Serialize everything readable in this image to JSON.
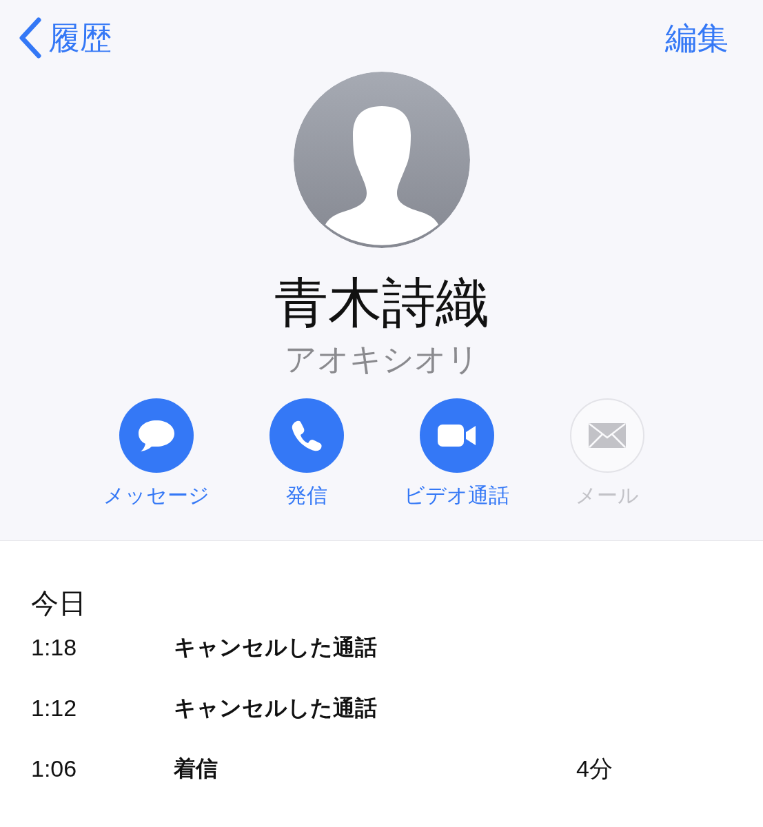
{
  "nav": {
    "back": "履歴",
    "edit": "編集"
  },
  "contact": {
    "name": "青木詩織",
    "reading": "アオキシオリ"
  },
  "actions": [
    {
      "label": "メッセージ",
      "kind": "message",
      "disabled": false
    },
    {
      "label": "発信",
      "kind": "call",
      "disabled": false
    },
    {
      "label": "ビデオ通話",
      "kind": "video",
      "disabled": false
    },
    {
      "label": "メール",
      "kind": "mail",
      "disabled": true
    }
  ],
  "history": {
    "heading": "今日",
    "calls": [
      {
        "time": "1:18",
        "type": "キャンセルした通話"
      },
      {
        "time": "1:12",
        "type": "キャンセルした通話"
      },
      {
        "time": "1:06",
        "type": "着信",
        "duration": "4分"
      }
    ]
  }
}
